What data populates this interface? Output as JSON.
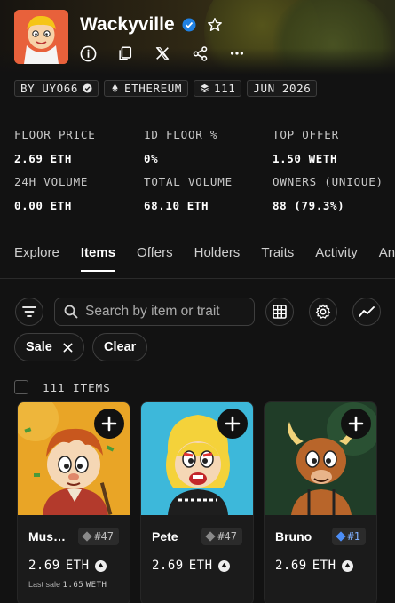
{
  "collection": {
    "name": "Wackyville",
    "chips": [
      "BY UYO66",
      "ETHEREUM",
      "111",
      "JUN 2026"
    ]
  },
  "stats": [
    {
      "label": "FLOOR PRICE",
      "value": "2.69 ETH"
    },
    {
      "label": "1D FLOOR %",
      "value": "0%"
    },
    {
      "label": "TOP OFFER",
      "value": "1.50 WETH"
    },
    {
      "label": "24H VOLUME",
      "value": "0.00 ETH"
    },
    {
      "label": "TOTAL VOLUME",
      "value": "68.10 ETH"
    },
    {
      "label": "OWNERS (UNIQUE)",
      "value": "88 (79.3%)"
    }
  ],
  "tabs": [
    "Explore",
    "Items",
    "Offers",
    "Holders",
    "Traits",
    "Activity",
    "Ana"
  ],
  "active_tab": "Items",
  "search": {
    "placeholder": "Search by item or trait"
  },
  "filters": {
    "sale_label": "Sale",
    "clear_label": "Clear"
  },
  "items_count": "111 ITEMS",
  "cards": [
    {
      "name": "Mus…",
      "rank": "#47",
      "price": "2.69",
      "currency": "ETH",
      "last_sale_label": "Last sale",
      "last_sale_value": "1.65",
      "last_sale_currency": "WETH",
      "bg": "#e8a21e"
    },
    {
      "name": "Pete",
      "rank": "#47",
      "price": "2.69",
      "currency": "ETH",
      "bg": "#3bb5d6"
    },
    {
      "name": "Bruno",
      "rank": "#1",
      "price": "2.69",
      "currency": "ETH",
      "bg": "#1f3a25"
    }
  ]
}
